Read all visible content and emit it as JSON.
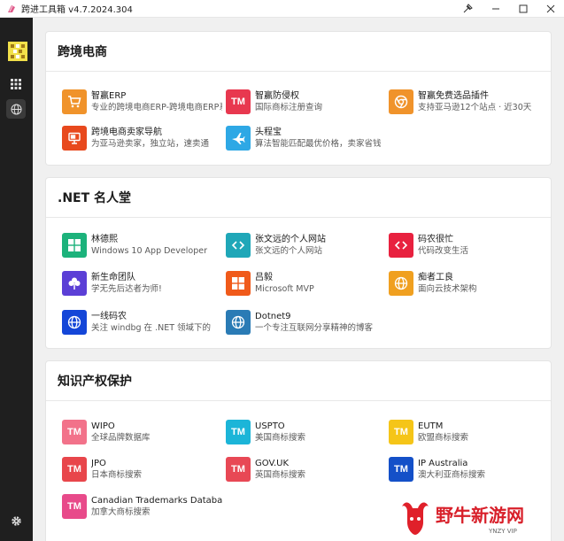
{
  "window": {
    "title": "跨进工具箱 v4.7.2024.304",
    "controls": [
      "pin-icon",
      "minimize-icon",
      "maximize-icon",
      "close-icon"
    ]
  },
  "rail": {
    "items": [
      {
        "name": "apps-grid-icon",
        "active": false
      },
      {
        "name": "globe-icon",
        "active": true
      }
    ],
    "settings_icon": "settings-icon"
  },
  "sections": [
    {
      "title": "跨境电商",
      "items": [
        {
          "name": "智赢ERP",
          "desc": "专业的跨境电商ERP-跨境电商ERP系统",
          "icon": "cart-icon",
          "color": "#f0932b",
          "glyph": ""
        },
        {
          "name": "智赢防侵权",
          "desc": "国际商标注册查询",
          "icon": "tm-icon",
          "color": "#e8384f",
          "glyph": "TM"
        },
        {
          "name": "智赢免费选品插件",
          "desc": "支持亚马逊12个站点 · 近30天",
          "icon": "chrome-icon",
          "color": "#f0932b",
          "glyph": ""
        },
        {
          "name": "跨境电商卖家导航",
          "desc": "为亚马逊卖家，独立站，速卖通",
          "icon": "presentation-icon",
          "color": "#e8491d",
          "glyph": ""
        },
        {
          "name": "头程宝",
          "desc": "算法智能匹配最优价格，卖家省钱",
          "icon": "airplane-icon",
          "color": "#2ea8e5",
          "glyph": ""
        }
      ]
    },
    {
      "title": ".NET 名人堂",
      "items": [
        {
          "name": "林德熙",
          "desc": "Windows 10 App Developer",
          "icon": "windows-icon",
          "color": "#1cb27b",
          "glyph": ""
        },
        {
          "name": "张文远的个人网站",
          "desc": "张文远的个人网站",
          "icon": "code-icon",
          "color": "#1fa7b8",
          "glyph": ""
        },
        {
          "name": "码农很忙",
          "desc": "代码改变生活",
          "icon": "code-icon",
          "color": "#e8213f",
          "glyph": ""
        },
        {
          "name": "新生命团队",
          "desc": "学无先后达者为师!",
          "icon": "clover-icon",
          "color": "#5b3fd6",
          "glyph": ""
        },
        {
          "name": "吕毅",
          "desc": "Microsoft MVP",
          "icon": "windows-icon",
          "color": "#f05a1a",
          "glyph": ""
        },
        {
          "name": "痴者工良",
          "desc": "面向云技术架构",
          "icon": "globe-icon",
          "color": "#f0a020",
          "glyph": ""
        },
        {
          "name": "一线码农",
          "desc": "关注 windbg 在 .NET 领域下的",
          "icon": "globe-icon",
          "color": "#1446d8",
          "glyph": ""
        },
        {
          "name": "Dotnet9",
          "desc": "一个专注互联网分享精神的博客",
          "icon": "globe-icon",
          "color": "#2a7bb5",
          "glyph": ""
        }
      ]
    },
    {
      "title": "知识产权保护",
      "items": [
        {
          "name": "WIPO",
          "desc": "全球品牌数据库",
          "icon": "tm-icon",
          "color": "#f2728a",
          "glyph": "TM"
        },
        {
          "name": "USPTO",
          "desc": "美国商标搜索",
          "icon": "tm-icon",
          "color": "#1cb5d8",
          "glyph": "TM"
        },
        {
          "name": "EUTM",
          "desc": "欧盟商标搜索",
          "icon": "tm-icon",
          "color": "#f5c518",
          "glyph": "TM"
        },
        {
          "name": "JPO",
          "desc": "日本商标搜索",
          "icon": "tm-icon",
          "color": "#e8464b",
          "glyph": "TM"
        },
        {
          "name": "GOV.UK",
          "desc": "英国商标搜索",
          "icon": "tm-icon",
          "color": "#e84855",
          "glyph": "TM"
        },
        {
          "name": "IP Australia",
          "desc": "澳大利亚商标搜索",
          "icon": "tm-icon",
          "color": "#1450c8",
          "glyph": "TM"
        },
        {
          "name": "Canadian Trademarks Database",
          "desc": "加拿大商标搜索",
          "icon": "tm-icon",
          "color": "#e84a8a",
          "glyph": "TM"
        }
      ]
    }
  ],
  "watermark": {
    "text": "野牛新游网",
    "sub": "YNZY VIP"
  }
}
